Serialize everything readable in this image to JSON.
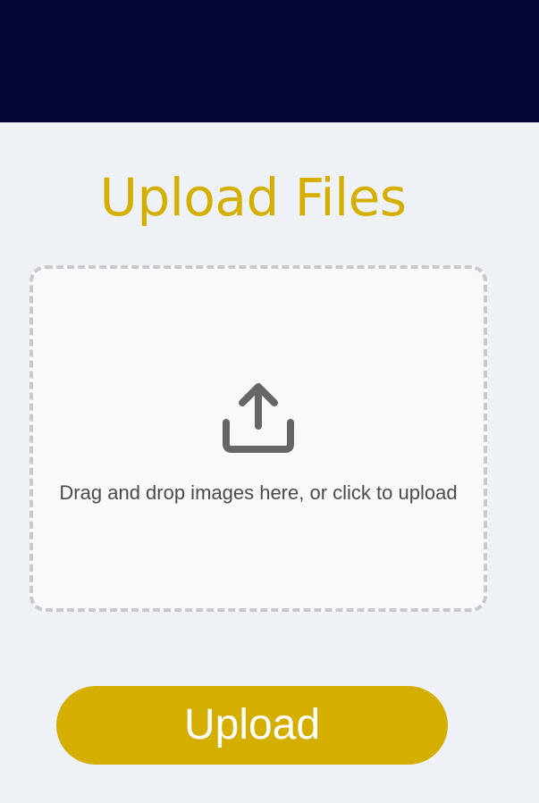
{
  "header": {
    "background_color": "#070733"
  },
  "main": {
    "title": "Upload Files",
    "title_color": "#d4ae00",
    "drop_zone": {
      "icon": "upload-icon",
      "text": "Drag and drop images here, or click to upload",
      "border_color": "#c8c9cc",
      "background_color": "#f8f9fa"
    },
    "upload_button": {
      "label": "Upload",
      "background_color": "#d4ae00",
      "text_color": "#ffffff"
    }
  },
  "page": {
    "background_color": "#eef2f7"
  }
}
